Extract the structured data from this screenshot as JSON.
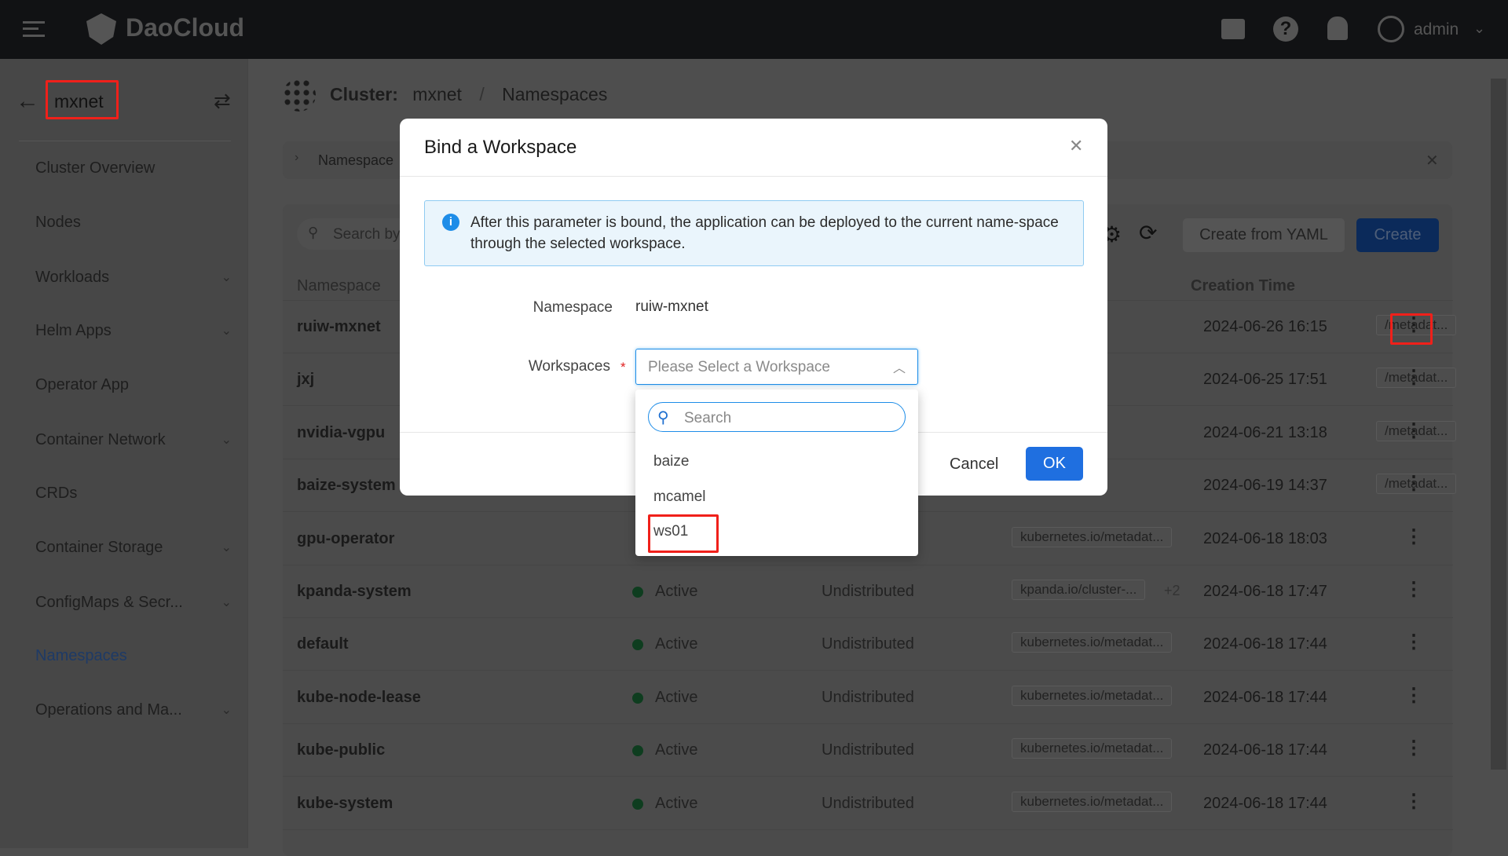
{
  "topbar": {
    "brand": "DaoCloud",
    "user": "admin"
  },
  "sidebar": {
    "cluster": "mxnet",
    "items": [
      {
        "label": "Cluster Overview",
        "chevron": false
      },
      {
        "label": "Nodes",
        "chevron": false
      },
      {
        "label": "Workloads",
        "chevron": true
      },
      {
        "label": "Helm Apps",
        "chevron": true
      },
      {
        "label": "Operator App",
        "chevron": false
      },
      {
        "label": "Container Network",
        "chevron": true
      },
      {
        "label": "CRDs",
        "chevron": false
      },
      {
        "label": "Container Storage",
        "chevron": true
      },
      {
        "label": "ConfigMaps & Secr...",
        "chevron": true
      },
      {
        "label": "Namespaces",
        "chevron": false,
        "active": true
      },
      {
        "label": "Operations and Ma...",
        "chevron": true
      }
    ]
  },
  "breadcrumb": {
    "prefix": "Cluster:",
    "cluster": "mxnet",
    "sep": "/",
    "page": "Namespaces"
  },
  "banner": {
    "label": "Namespace"
  },
  "toolbar": {
    "search_placeholder": "Search by",
    "create_yaml": "Create from YAML",
    "create": "Create"
  },
  "table": {
    "headers": {
      "namespace": "Namespace",
      "creation_time": "Creation Time"
    },
    "rows": [
      {
        "name": "ruiw-mxnet",
        "status": "",
        "workspace": "",
        "label": "/metadat...",
        "extra": "",
        "time": "2024-06-26 16:15"
      },
      {
        "name": "jxj",
        "status": "",
        "workspace": "",
        "label": "/metadat...",
        "extra": "",
        "time": "2024-06-25 17:51"
      },
      {
        "name": "nvidia-vgpu",
        "status": "",
        "workspace": "",
        "label": "/metadat...",
        "extra": "",
        "time": "2024-06-21 13:18"
      },
      {
        "name": "baize-system",
        "status": "",
        "workspace": "",
        "label": "/metadat...",
        "extra": "",
        "time": "2024-06-19 14:37"
      },
      {
        "name": "gpu-operator",
        "status": "",
        "workspace": "",
        "label": "kubernetes.io/metadat...",
        "extra": "",
        "time": "2024-06-18 18:03"
      },
      {
        "name": "kpanda-system",
        "status": "Active",
        "workspace": "Undistributed",
        "label": "kpanda.io/cluster-...",
        "extra": "+2",
        "time": "2024-06-18 17:47"
      },
      {
        "name": "default",
        "status": "Active",
        "workspace": "Undistributed",
        "label": "kubernetes.io/metadat...",
        "extra": "",
        "time": "2024-06-18 17:44"
      },
      {
        "name": "kube-node-lease",
        "status": "Active",
        "workspace": "Undistributed",
        "label": "kubernetes.io/metadat...",
        "extra": "",
        "time": "2024-06-18 17:44"
      },
      {
        "name": "kube-public",
        "status": "Active",
        "workspace": "Undistributed",
        "label": "kubernetes.io/metadat...",
        "extra": "",
        "time": "2024-06-18 17:44"
      },
      {
        "name": "kube-system",
        "status": "Active",
        "workspace": "Undistributed",
        "label": "kubernetes.io/metadat...",
        "extra": "",
        "time": "2024-06-18 17:44"
      }
    ]
  },
  "dialog": {
    "title": "Bind a Workspace",
    "info": "After this parameter is bound, the application can be deployed to the current name-space through the selected workspace.",
    "namespace_label": "Namespace",
    "namespace_value": "ruiw-mxnet",
    "workspaces_label": "Workspaces",
    "required_mark": "*",
    "select_placeholder": "Please Select a Workspace",
    "search_placeholder": "Search",
    "options": [
      "baize",
      "mcamel",
      "ws01"
    ],
    "cancel": "Cancel",
    "ok": "OK"
  },
  "colors": {
    "primary": "#1f6fe0",
    "highlight": "#f0201a",
    "active_dot": "#0e3d1f"
  }
}
